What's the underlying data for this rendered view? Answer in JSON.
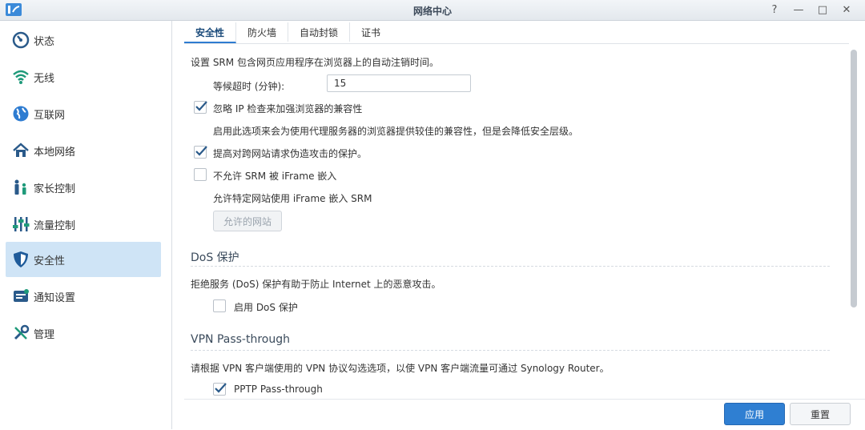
{
  "window": {
    "title": "网络中心"
  },
  "controls": {
    "help": "?",
    "minimize": "—",
    "maximize": "□",
    "close": "✕"
  },
  "sidebar": {
    "items": [
      {
        "label": "状态"
      },
      {
        "label": "无线"
      },
      {
        "label": "互联网"
      },
      {
        "label": "本地网络"
      },
      {
        "label": "家长控制"
      },
      {
        "label": "流量控制"
      },
      {
        "label": "安全性"
      },
      {
        "label": "通知设置"
      },
      {
        "label": "管理"
      }
    ],
    "active_index": 6
  },
  "tabs": [
    {
      "label": "安全性"
    },
    {
      "label": "防火墙"
    },
    {
      "label": "自动封锁"
    },
    {
      "label": "证书"
    }
  ],
  "security": {
    "intro": "设置 SRM 包含网页应用程序在浏览器上的自动注销时间。",
    "timeout_label": "等候超时 (分钟):",
    "timeout_value": "15",
    "ignore_ip_label": "忽略 IP 检查来加强浏览器的兼容性",
    "ignore_ip_checked": true,
    "ignore_ip_desc": "启用此选项来会为使用代理服务器的浏览器提供较佳的兼容性，但是会降低安全层级。",
    "csrf_label": "提高对跨网站请求伪造攻击的保护。",
    "csrf_checked": true,
    "iframe_label": "不允许 SRM 被 iFrame 嵌入",
    "iframe_checked": false,
    "iframe_desc": "允许特定网站使用 iFrame 嵌入 SRM",
    "allowed_sites_button": "允许的网站"
  },
  "dos": {
    "title": "DoS 保护",
    "desc": "拒绝服务 (DoS) 保护有助于防止 Internet 上的恶意攻击。",
    "enable_label": "启用 DoS 保护",
    "enable_checked": false
  },
  "vpn": {
    "title": "VPN Pass-through",
    "desc": "请根据 VPN 客户端使用的 VPN 协议勾选选项，以使 VPN 客户端流量可通过 Synology Router。",
    "pptp_label": "PPTP Pass-through",
    "pptp_checked": true
  },
  "footer": {
    "apply": "应用",
    "reset": "重置"
  },
  "colors": {
    "accent": "#2f7fd2",
    "active_nav": "#cfe4f6"
  }
}
